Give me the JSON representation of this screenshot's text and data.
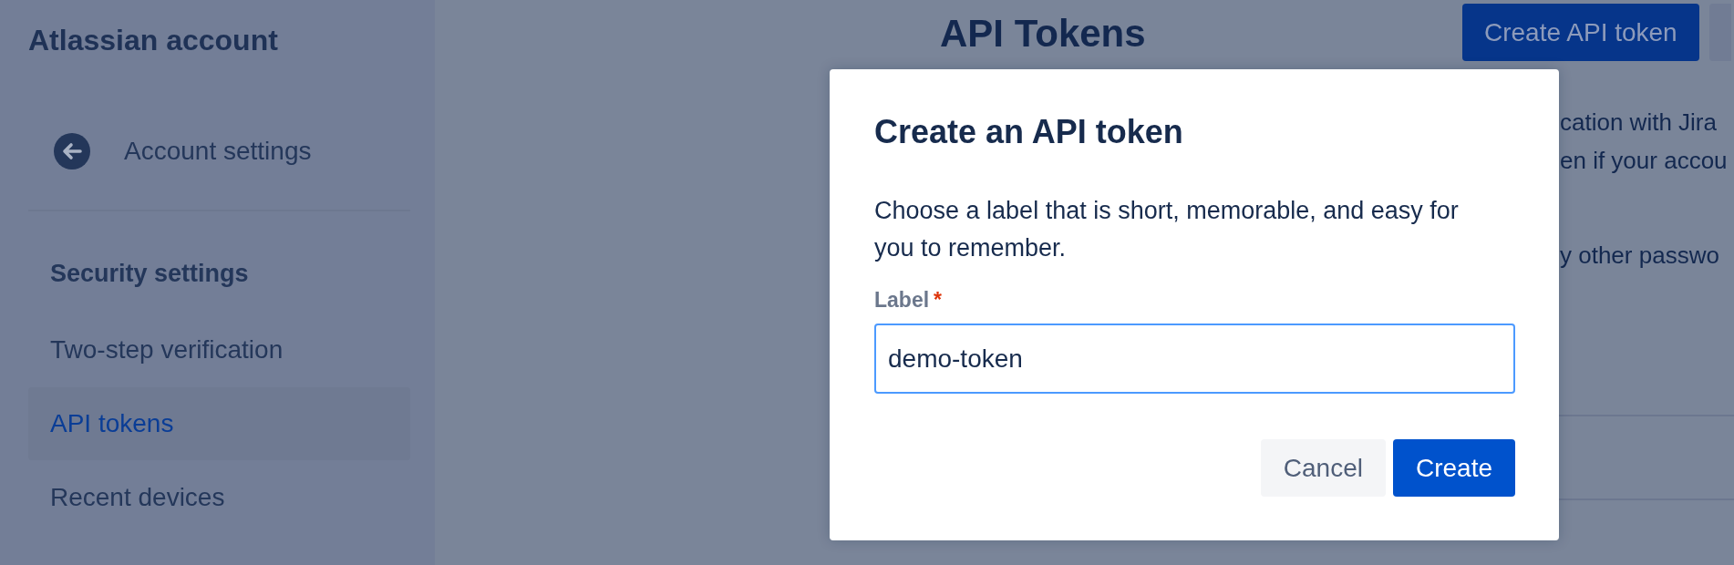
{
  "sidebar": {
    "title": "Atlassian account",
    "back_link": {
      "label": "Account settings"
    },
    "section_heading": "Security settings",
    "items": [
      {
        "label": "Two-step verification",
        "selected": false
      },
      {
        "label": "API tokens",
        "selected": true
      },
      {
        "label": "Recent devices",
        "selected": false
      }
    ]
  },
  "page": {
    "title": "API Tokens",
    "buttons": [
      {
        "kind": "primary",
        "label": "Create API token"
      },
      {
        "kind": "secondary"
      }
    ],
    "paragraphs": [
      {
        "lines": [
          "cation with Jira",
          "en if your accou"
        ]
      },
      {
        "lines": [
          "y other passwo"
        ]
      }
    ]
  },
  "dialog": {
    "title": "Create an API token",
    "description": "Choose a label that is short, memorable, and easy for you to remember.",
    "field": {
      "label": "Label",
      "required_mark": "*",
      "value": "demo-token",
      "focused": true
    },
    "buttons": [
      {
        "kind": "subtle",
        "label": "Cancel"
      },
      {
        "kind": "primary",
        "label": "Create"
      }
    ]
  }
}
